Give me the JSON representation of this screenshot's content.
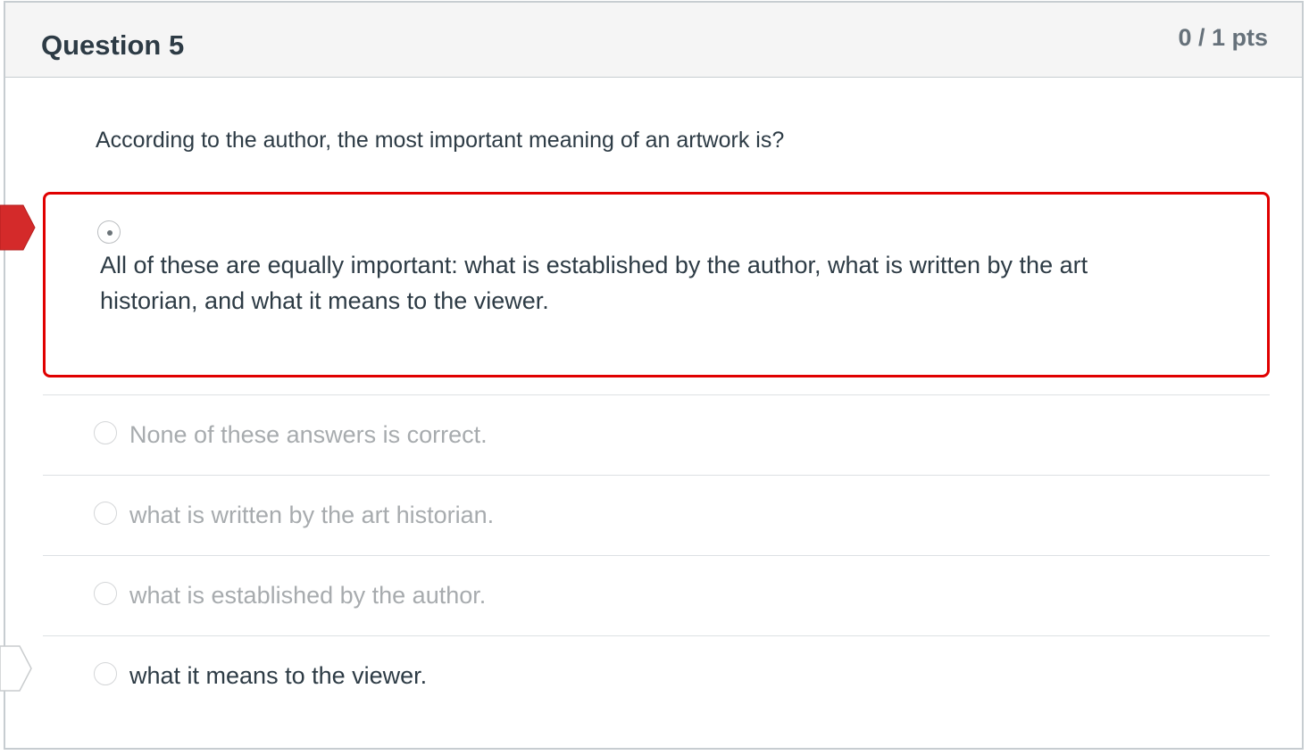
{
  "question": {
    "title": "Question 5",
    "points": "0 / 1 pts",
    "text": "According to the author, the most important meaning of an artwork is?"
  },
  "answers": [
    {
      "label": "All of these are equally important: what is established by the author, what is written by the art historian, and what it means to the viewer.",
      "selected": true,
      "state": "incorrect"
    },
    {
      "label": "None of these answers is correct.",
      "selected": false
    },
    {
      "label": "what is written by the art historian.",
      "selected": false
    },
    {
      "label": "what is established by the author.",
      "selected": false
    },
    {
      "label": "what it means to the viewer.",
      "selected": false,
      "state": "correct"
    }
  ],
  "colors": {
    "wrong_marker": "#d42a2a",
    "selected_border": "#e00000",
    "correct_marker": "#ffffff"
  },
  "icons": {
    "wrong_marker": "arrow-flag-icon",
    "correct_marker": "arrow-flag-icon"
  }
}
